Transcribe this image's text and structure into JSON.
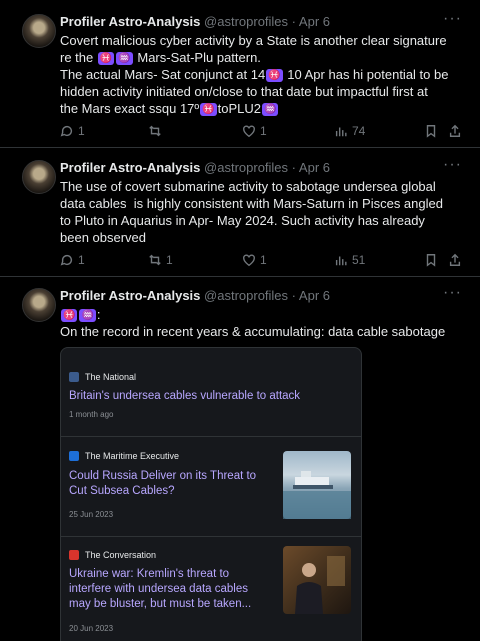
{
  "tweets": [
    {
      "name": "Profiler Astro-Analysis",
      "handle": "@astroprofiles",
      "date": "Apr 6",
      "lines": {
        "l1": "Covert malicious cyber activity by a State is another clear signature",
        "l2a": "re the ",
        "l2z1": "♓",
        "l2z2": "♒",
        "l2b": " Mars-Sat-Plu pattern.",
        "l3a": "The actual Mars- Sat conjunct at 14",
        "l3z": "♓",
        "l3b": " 10 Apr has hi potential to be",
        "l4": "hidden activity initiated on/close to that date but impactful first at",
        "l5a": "the Mars exact ssqu 17º",
        "l5z1": "♓",
        "l5b": "toPLU2",
        "l5z2": "♒"
      },
      "replies": "1",
      "retweets": "",
      "likes": "1",
      "views": "74"
    },
    {
      "name": "Profiler Astro-Analysis",
      "handle": "@astroprofiles",
      "date": "Apr 6",
      "lines": {
        "l1": "The use of covert submarine activity to sabotage undersea global",
        "l2": "data cables  is highly consistent with Mars-Saturn in Pisces angled",
        "l3": "to Pluto in Aquarius in Apr- May 2024. Such activity has already",
        "l4": "been observed"
      },
      "replies": "1",
      "retweets": "1",
      "likes": "1",
      "views": "51"
    },
    {
      "name": "Profiler Astro-Analysis",
      "handle": "@astroprofiles",
      "date": "Apr 6",
      "lines": {
        "l1z1": "♓",
        "l1z2": "♒",
        "l1b": ":",
        "l2": "On the record in recent years & accumulating: data cable sabotage"
      }
    }
  ],
  "cards": [
    {
      "source": "The National",
      "logo_color": "#3b5b8c",
      "headline1": "Britain's undersea cables vulnerable to attack",
      "date": "1 month ago"
    },
    {
      "source": "The Maritime Executive",
      "logo_color": "#1d6fd8",
      "headline1": "Could Russia Deliver on its Threat to",
      "headline2": "Cut Subsea Cables?",
      "date": "25 Jun 2023",
      "thumb": "ship-at-sea-photo"
    },
    {
      "source": "The Conversation",
      "logo_color": "#d8342c",
      "headline1": "Ukraine war: Kremlin's threat to",
      "headline2": "interfere with undersea data cables",
      "headline3": "may be bluster, but must be taken...",
      "date": "20 Jun 2023",
      "thumb": "man-in-office-photo"
    }
  ]
}
